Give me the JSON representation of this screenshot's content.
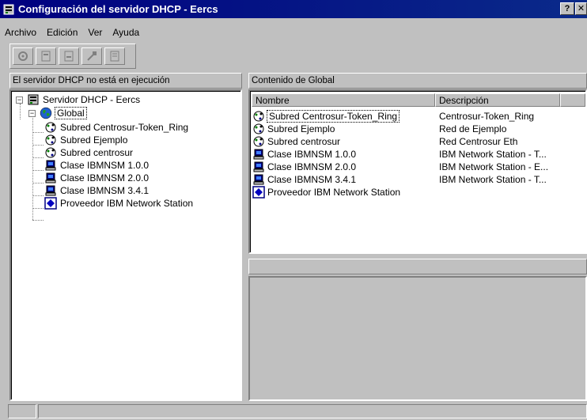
{
  "window": {
    "title": "Configuración del servidor DHCP - Eercs",
    "help_label": "?",
    "close_label": "✕"
  },
  "menu": [
    "Archivo",
    "Edición",
    "Ver",
    "Ayuda"
  ],
  "left_panel": {
    "header": "El servidor DHCP no está en ejecución",
    "tree": {
      "root": "Servidor DHCP - Eercs",
      "global": "Global",
      "children": [
        {
          "label": "Subred Centrosur-Token_Ring",
          "icon": "subnet-icon"
        },
        {
          "label": "Subred Ejemplo",
          "icon": "subnet-icon"
        },
        {
          "label": "Subred centrosur",
          "icon": "subnet-icon"
        },
        {
          "label": "Clase IBMNSM 1.0.0",
          "icon": "class-icon"
        },
        {
          "label": "Clase IBMNSM 2.0.0",
          "icon": "class-icon"
        },
        {
          "label": "Clase IBMNSM 3.4.1",
          "icon": "class-icon"
        },
        {
          "label": "Proveedor IBM Network Station",
          "icon": "vendor-icon"
        }
      ]
    }
  },
  "right_panel": {
    "header": "Contenido de Global",
    "columns": [
      "Nombre",
      "Descripción"
    ],
    "rows": [
      {
        "name": "Subred Centrosur-Token_Ring",
        "description": "Centrosur-Token_Ring",
        "icon": "subnet-icon"
      },
      {
        "name": "Subred Ejemplo",
        "description": "Red de Ejemplo",
        "icon": "subnet-icon"
      },
      {
        "name": "Subred centrosur",
        "description": "Red Centrosur Eth",
        "icon": "subnet-icon"
      },
      {
        "name": "Clase IBMNSM 1.0.0",
        "description": "IBM Network Station - T...",
        "icon": "class-icon"
      },
      {
        "name": "Clase IBMNSM 2.0.0",
        "description": "IBM Network Station - E...",
        "icon": "class-icon"
      },
      {
        "name": "Clase IBMNSM 3.4.1",
        "description": "IBM Network Station - T...",
        "icon": "class-icon"
      },
      {
        "name": "Proveedor IBM Network Station",
        "description": "",
        "icon": "vendor-icon"
      }
    ]
  }
}
